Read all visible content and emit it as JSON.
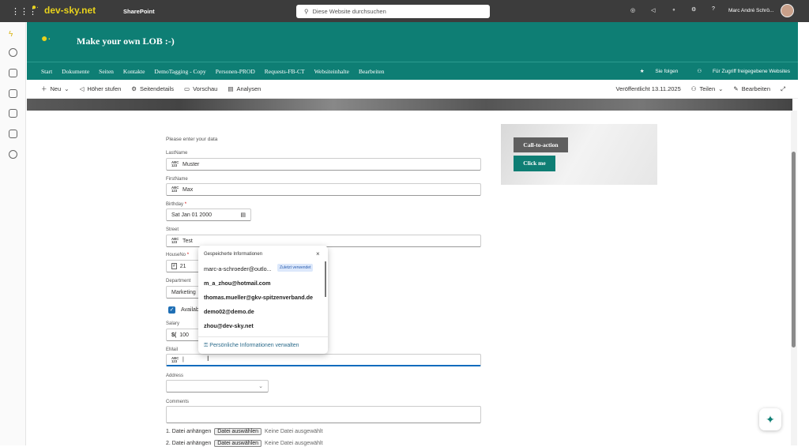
{
  "topbar": {
    "brand": "dev-sky.net",
    "app": "SharePoint",
    "search_placeholder": "Diese Website durchsuchen",
    "user": "Marc André Schrö..."
  },
  "site": {
    "title": "Make your own LOB :-)"
  },
  "nav": {
    "items": [
      "Start",
      "Dokumente",
      "Seiten",
      "Kontakte",
      "DemoTagging - Copy",
      "Personen-PROD",
      "Requests-FB-CT",
      "Websiteinhalte",
      "Bearbeiten"
    ],
    "follow": "Sie folgen",
    "shared": "Für Zugriff freigegebene Websites"
  },
  "cmd": {
    "new": "Neu",
    "promote": "Höher stufen",
    "details": "Seitendetails",
    "preview": "Vorschau",
    "analytics": "Analysen",
    "published": "Veröffentlicht 13.11.2025",
    "share": "Teilen",
    "edit": "Bearbeiten"
  },
  "form": {
    "intro": "Please enter your data",
    "lastname_label": "LastName",
    "lastname": "Muster",
    "firstname_label": "FirstName",
    "firstname": "Max",
    "birthday_label": "Birthday",
    "birthday": "Sat Jan 01 2000",
    "street_label": "Street",
    "street": "Test",
    "houseno_label": "HouseNo",
    "houseno": "21",
    "department_label": "Department",
    "department": "Marketing",
    "available_label": "Availab",
    "salary_label": "Salary",
    "salary": "100",
    "email_label": "EMail",
    "address_label": "Address",
    "comments_label": "Comments",
    "attach1": "1. Datei anhängen",
    "attach2": "2. Datei anhängen",
    "choose": "Datei auswählen",
    "nofile": "Keine Datei ausgewählt",
    "abc": "ABC",
    "n123": "123",
    "required": "*"
  },
  "autofill": {
    "title": "Gespeicherte Informationen",
    "items": [
      "marc-a-schroeder@outlo...",
      "m_a_zhou@hotmail.com",
      "thomas.mueller@gkv-spitzenverband.de",
      "demo02@demo.de",
      "zhou@dev-sky.net"
    ],
    "badge": "Zuletzt verwendet",
    "manage": "Persönliche Informationen verwalten"
  },
  "cta": {
    "label": "Call-to-action",
    "button": "Click me"
  },
  "colors": {
    "teal": "#0e7e74",
    "topbar": "#3c3c3c"
  }
}
